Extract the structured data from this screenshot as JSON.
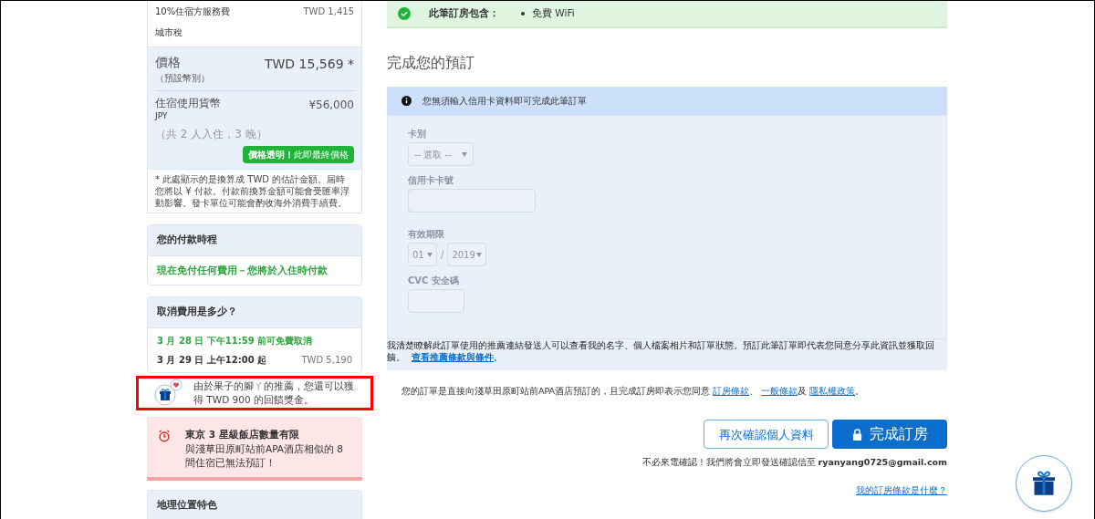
{
  "price_card": {
    "fees": [
      {
        "label": "10%住宿方服務費",
        "amount": "TWD 1,415"
      },
      {
        "label": "城市稅"
      }
    ],
    "price": {
      "label": "價格",
      "sub": "（預設幣別）",
      "amount": "TWD 15,569 *"
    },
    "local": {
      "label": "住宿使用貨幣",
      "code": "JPY",
      "amount": "¥56,000"
    },
    "guests": "（共 2 人入住，3 晚）",
    "badge": "**價格透明！**此即最終價格",
    "note": "* 此處顯示的是換算成 TWD 的估計金額。屆時您將以 ¥ 付款。付款前換算金額可能會受匯率浮動影響。發卡單位可能會酌收海外消費手續費。"
  },
  "payment_card": {
    "title": "您的付款時程",
    "text": "現在免付任何費用－您將於入住時付款"
  },
  "cancel_card": {
    "title": "取消費用是多少？",
    "rows": [
      {
        "kind": "free",
        "label": "3 月 28 日 下午11:59 前可免費取消"
      },
      {
        "kind": "fee",
        "label": "3 月 29 日 上午12:00 起",
        "amount": "TWD 5,190"
      }
    ]
  },
  "referral": {
    "highlighted": true,
    "text": "由於果子的腳ㄚ的推薦，您還可以獲得 TWD 900 的回饋獎金。"
  },
  "alert": {
    "title": "東京 3 星級飯店數量有限",
    "text": "與淺草田原町站前APA酒店相似的 8 間住宿已無法預訂！"
  },
  "location_card": {
    "title": "地理位置特色"
  },
  "includes": {
    "label": "此筆訂房包含：",
    "items": [
      "免費 WiFi"
    ]
  },
  "heading": "完成您的預訂",
  "info": "您無須輸入信用卡資料即可完成此筆訂單",
  "form": {
    "disabled": true,
    "card_type": {
      "label": "卡別",
      "value": "-- 選取 --"
    },
    "card_number": {
      "label": "信用卡卡號"
    },
    "expiry": {
      "label": "有效期限",
      "month": "01",
      "separator": "/",
      "year": "2019"
    },
    "cvc": {
      "label": "CVC 安全碼"
    }
  },
  "consent": {
    "text": "我清楚瞭解此訂單使用的推薦連結發送人可以查看我的名字、個人檔案相片和訂單狀態。預訂此筆訂單即代表您同意分享此資訊並獲取回饋。",
    "link": "查看推薦條款與條件",
    "end": "。"
  },
  "terms": {
    "text": "您的訂單是直接向淺草田原町站前APA酒店預訂的，且完成訂房即表示您同意",
    "links": [
      "訂房條款",
      "一般條款",
      "隱私權政策"
    ],
    "separators": [
      "、",
      "及",
      "。"
    ]
  },
  "buttons": {
    "review": "再次確認個人資料",
    "complete": "完成訂房"
  },
  "confirm": {
    "text": "不必來電確認！我們將會立即發送確認信至",
    "email": "ryanyang0725@gmail.com"
  },
  "faq_link": "我的訂房條款是什麼？"
}
